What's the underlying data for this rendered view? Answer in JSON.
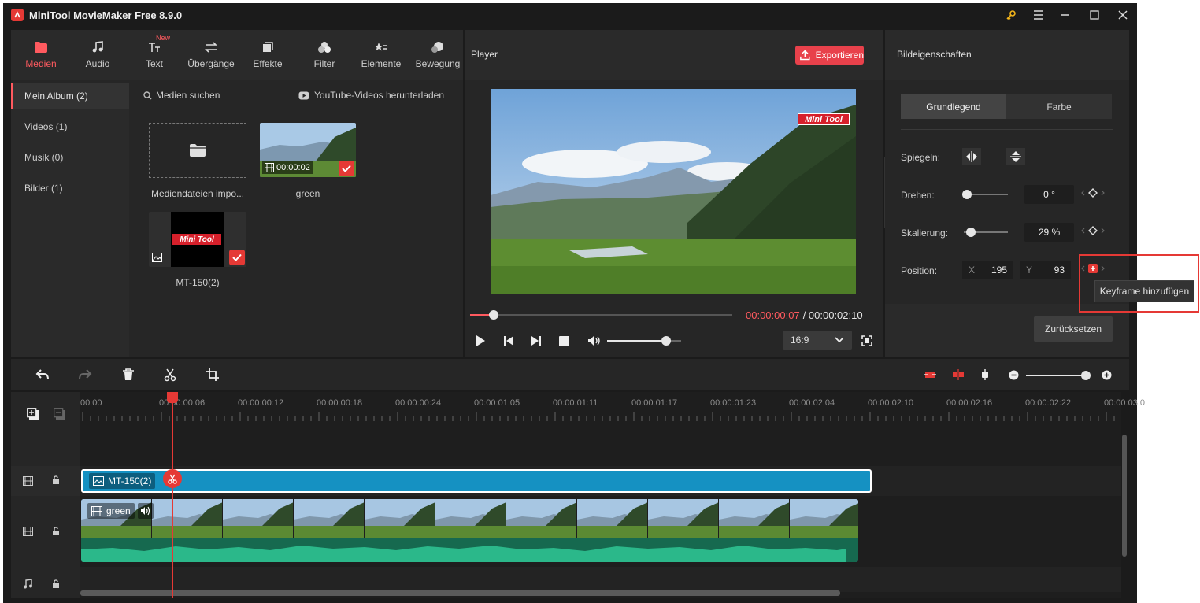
{
  "app": {
    "title": "MiniTool MovieMaker Free 8.9.0"
  },
  "tabs": [
    {
      "label": "Medien",
      "icon": "folder-icon"
    },
    {
      "label": "Audio",
      "icon": "music-note-icon"
    },
    {
      "label": "Text",
      "icon": "text-icon",
      "badge": "New"
    },
    {
      "label": "Übergänge",
      "icon": "transition-icon"
    },
    {
      "label": "Effekte",
      "icon": "effects-icon"
    },
    {
      "label": "Filter",
      "icon": "filter-icon"
    },
    {
      "label": "Elemente",
      "icon": "elements-icon"
    },
    {
      "label": "Bewegung",
      "icon": "motion-icon"
    }
  ],
  "albums": [
    {
      "label": "Mein Album (2)"
    },
    {
      "label": "Videos (1)"
    },
    {
      "label": "Musik (0)"
    },
    {
      "label": "Bilder (1)"
    }
  ],
  "media": {
    "search_label": "Medien suchen",
    "youtube_label": "YouTube-Videos herunterladen",
    "import_label": "Mediendateien impo...",
    "items": [
      {
        "name": "green",
        "duration": "00:00:02"
      },
      {
        "name": "MT-150(2)",
        "logo_text": "Mini Tool"
      }
    ]
  },
  "player": {
    "title": "Player",
    "export_label": "Exportieren",
    "current_time": "00:00:00:07",
    "total_time": "/ 00:00:02:10",
    "aspect": "16:9",
    "watermark": "Mini Tool",
    "progress": 0.09,
    "volume": 0.8
  },
  "properties": {
    "title": "Bildeigenschaften",
    "tab_basic": "Grundlegend",
    "tab_color": "Farbe",
    "mirror_label": "Spiegeln:",
    "rotate_label": "Drehen:",
    "rotate_value": "0 °",
    "scale_label": "Skalierung:",
    "scale_value": "29 %",
    "position_label": "Position:",
    "x_label": "X",
    "x_value": "195",
    "y_label": "Y",
    "y_value": "93",
    "tooltip": "Keyframe hinzufügen",
    "reset_label": "Zurücksetzen"
  },
  "timeline": {
    "ticks": [
      "00:00",
      "00:00:00:06",
      "00:00:00:12",
      "00:00:00:18",
      "00:00:00:24",
      "00:00:01:05",
      "00:00:01:11",
      "00:00:01:17",
      "00:00:01:23",
      "00:00:02:04",
      "00:00:02:10",
      "00:00:02:16",
      "00:00:02:22",
      "00:00:03:0"
    ],
    "image_clip": "MT-150(2)",
    "video_clip": "green"
  },
  "colors": {
    "accent": "#ff5a5f",
    "clip_image": "#1591c2",
    "audio_wave": "#2bb88a"
  }
}
